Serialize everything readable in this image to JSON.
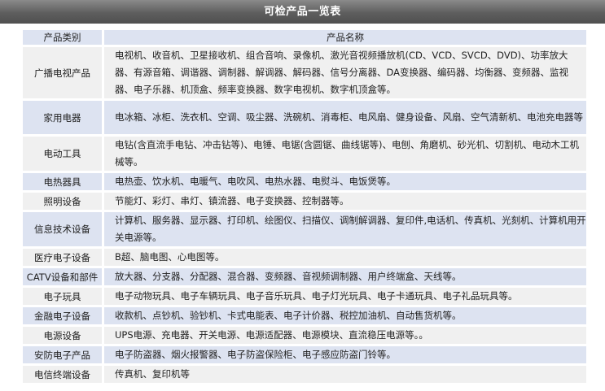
{
  "title": "可检产品一览表",
  "table": {
    "headers": [
      "产品类别",
      "产品名称"
    ],
    "rows": [
      {
        "category": "广播电视产品",
        "products": "电视机、收音机、卫星接收机、组合音响、录像机、激光音视频播放机(CD、VCD、SVCD、DVD)、功率放大器、有源音箱、调谐器、调制器、解调器、解码器、信号分离器、DA变换器、编码器、均衡器、变频器、监视器、电子乐器、机顶盒、频率变换器、数字电视机、数字机顶盒等。"
      },
      {
        "category": "家用电器",
        "products": "电冰箱、冰柜、洗衣机、空调、吸尘器、洗碗机、消毒柜、电风扇、健身设备、风扇、空气清新机、电池充电器等"
      },
      {
        "category": "电动工具",
        "products": "电钻(含直流手电钻、冲击钻等)、电锤、电锯(含圆锯、曲线锯等)、电刨、角磨机、砂光机、切割机、电动木工机械等。"
      },
      {
        "category": "电热器具",
        "products": "电热壶、饮水机、电暖气、电吹风、电热水器、电熨斗、电饭煲等。"
      },
      {
        "category": "照明设备",
        "products": "节能灯、彩灯、串灯、镇流器、电子变换器、控制器等。"
      },
      {
        "category": "信息技术设备",
        "products": "计算机、服务器、显示器、打印机、绘图仪、扫描仪、调制解调器、复印件,电话机、传真机、光刻机、计算机用开关电源等。"
      },
      {
        "category": "医疗电子设备",
        "products": "B超、脑电图、心电图等。"
      },
      {
        "category": "CATV设备和部件",
        "products": "放大器、分支器、分配器、混合器、变频器、音视频调制器、用户终端盒、天线等。"
      },
      {
        "category": "电子玩具",
        "products": "电子动物玩具、电子车辆玩具、电子音乐玩具、电子灯光玩具、电子卡通玩具、电子礼品玩具等。"
      },
      {
        "category": "金融电子设备",
        "products": "收款机、点钞机、验钞机、卡式电能表、电子计价器、税控加油机、自动售货机等。"
      },
      {
        "category": "电源设备",
        "products": "UPS电源、充电器、开关电源、电源适配器、电源模块、直流稳压电源等。。"
      },
      {
        "category": "安防电子产品",
        "products": "电子防盗器、烟火报警器、电子防盗保险柜、电子感应防盗门铃等。"
      },
      {
        "category": "电信终端设备",
        "products": "传真机、复印机等"
      }
    ]
  }
}
